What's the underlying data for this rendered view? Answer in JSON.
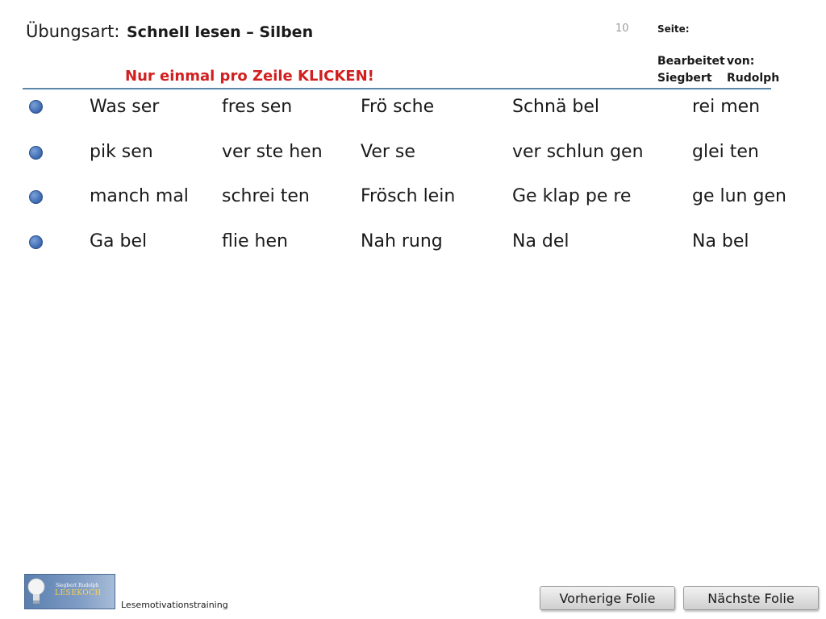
{
  "header": {
    "label": "Übungsart:",
    "title": "Schnell lesen – Silben",
    "instruction": "Nur einmal pro Zeile KLICKEN!",
    "slide_number": "10",
    "seite_label": "Seite:",
    "bearbeitet": "Bearbeitet",
    "von": "von:",
    "first_name": "Siegbert",
    "last_name": "Rudolph"
  },
  "rows": [
    [
      "Was ser",
      "fres sen",
      "Frö sche",
      "Schnä bel",
      "rei men"
    ],
    [
      "pik sen",
      "ver ste hen",
      "Ver se",
      "ver schlun gen",
      "glei ten"
    ],
    [
      "manch mal",
      "schrei ten",
      "Frösch lein",
      "Ge klap pe re",
      "ge lun gen"
    ],
    [
      "Ga bel",
      "flie hen",
      "Nah rung",
      "Na del",
      "Na bel"
    ]
  ],
  "footer": {
    "logo_small": "Siegbert Rudolph",
    "logo_big": "LESEKOCH",
    "caption": "Lesemotivationstraining",
    "prev_label": "Vorherige Folie",
    "next_label": "Nächste Folie"
  },
  "colors": {
    "instruction": "#d21f1f",
    "rule": "#5b87a8",
    "bullet": "#3b67b0"
  }
}
